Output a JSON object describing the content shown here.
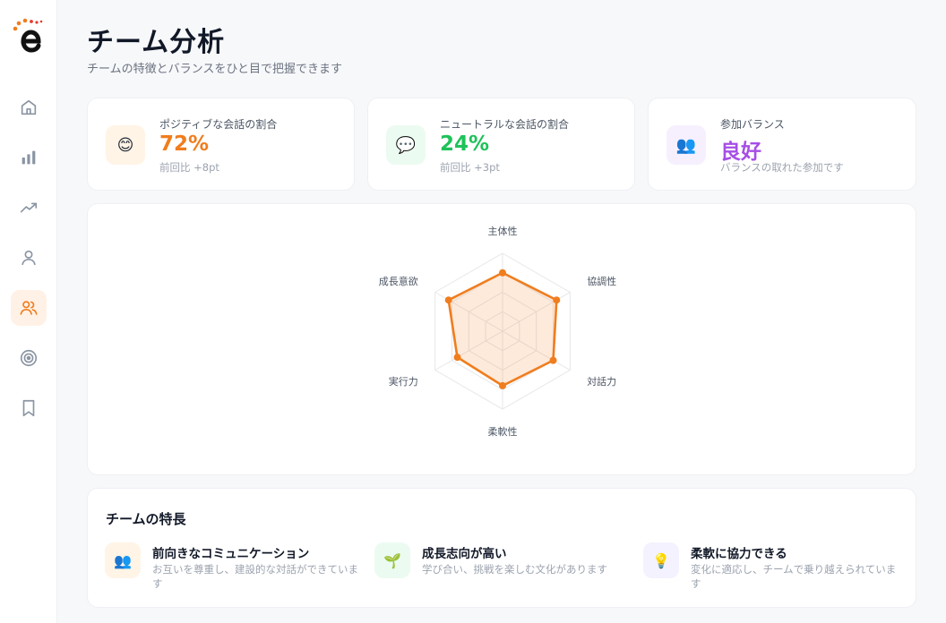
{
  "header": {
    "title": "チーム分析",
    "subtitle": "チームの特徴とバランスをひと目で把握できます"
  },
  "sidebar": {
    "items": [
      {
        "icon": "home-icon"
      },
      {
        "icon": "bar-chart-icon"
      },
      {
        "icon": "trending-up-icon"
      },
      {
        "icon": "user-icon"
      },
      {
        "icon": "users-icon",
        "active": true
      },
      {
        "icon": "target-icon"
      },
      {
        "icon": "bookmark-icon"
      }
    ]
  },
  "stats": [
    {
      "icon": "😊",
      "label": "ポジティブな会話の割合",
      "value": "72%",
      "sub": "前回比 +8pt",
      "color": "#f07d1e",
      "bg": "#fff4e6"
    },
    {
      "icon": "💬",
      "label": "ニュートラルな会話の割合",
      "value": "24%",
      "sub": "前回比 +3pt",
      "color": "#1ec25a",
      "bg": "#ecfbf1"
    },
    {
      "icon": "👥",
      "label": "参加バランス",
      "value": "良好",
      "sub": "バランスの取れた参加です",
      "color": "#a64ee6",
      "bg": "#f6f0fe"
    }
  ],
  "radar": {
    "labels": [
      "主体性",
      "協調性",
      "対話力",
      "柔軟性",
      "実行力",
      "成長意欲"
    ],
    "values": [
      0.75,
      0.8,
      0.75,
      0.7,
      0.67,
      0.8
    ],
    "color": "#f07d1e"
  },
  "traits": {
    "title": "チームの特長",
    "items": [
      {
        "icon": "👥",
        "title": "前向きなコミュニケーション",
        "desc": "お互いを尊重し、建設的な対話ができています",
        "bg": "#fff4e6"
      },
      {
        "icon": "🌱",
        "title": "成長志向が高い",
        "desc": "学び合い、挑戦を楽しむ文化があります",
        "bg": "#ecfbf1"
      },
      {
        "icon": "💡",
        "title": "柔軟に協力できる",
        "desc": "変化に適応し、チームで乗り越えられています",
        "bg": "#f4f2fe"
      }
    ]
  }
}
